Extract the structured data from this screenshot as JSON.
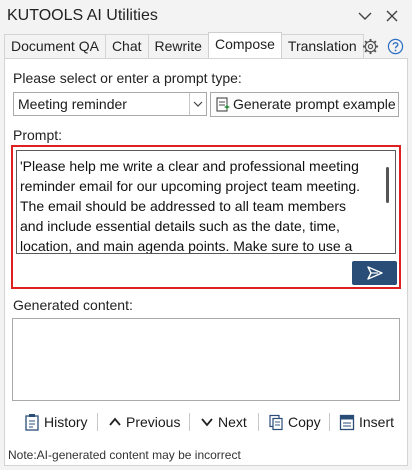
{
  "window": {
    "title": "KUTOOLS AI Utilities"
  },
  "tabs": [
    {
      "label": "Document QA",
      "active": false
    },
    {
      "label": "Chat",
      "active": false
    },
    {
      "label": "Rewrite",
      "active": false
    },
    {
      "label": "Compose",
      "active": true
    },
    {
      "label": "Translation",
      "active": false
    }
  ],
  "prompt_type": {
    "label": "Please select or enter a prompt type:",
    "selected": "Meeting reminder",
    "generate_label": "Generate prompt example"
  },
  "prompt": {
    "label": "Prompt:",
    "value": "'Please help me write a clear and professional meeting reminder email for our upcoming project team meeting. The email should be addressed to all team members and include essential details such as the date, time, location, and main agenda points. Make sure to use a polite and professional tone, encourage attendance, and avoid unnecessary details."
  },
  "generated": {
    "label": "Generated content:",
    "value": ""
  },
  "toolbar": {
    "history": "History",
    "previous": "Previous",
    "next": "Next",
    "copy": "Copy",
    "insert": "Insert"
  },
  "note": "Note:AI-generated content may be incorrect",
  "colors": {
    "accent": "#2a4d78",
    "highlight_border": "#e02020"
  }
}
